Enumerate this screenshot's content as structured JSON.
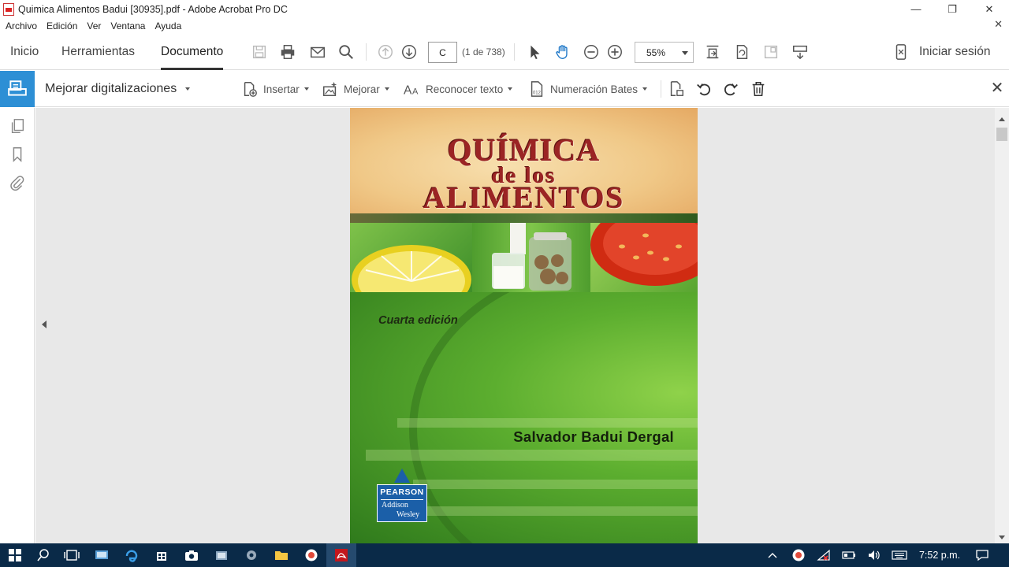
{
  "window": {
    "title": "Quimica Alimentos Badui [30935].pdf - Adobe Acrobat Pro DC",
    "minimize_label": "—",
    "maximize_label": "❐",
    "close_label": "✕"
  },
  "menu": {
    "items": [
      "Archivo",
      "Edición",
      "Ver",
      "Ventana",
      "Ayuda"
    ],
    "close_doc_label": "✕"
  },
  "nav": {
    "tabs": [
      "Inicio",
      "Herramientas",
      "Documento"
    ],
    "active_tab": "Documento",
    "page_input": "C",
    "page_count": "(1 de 738)",
    "zoom": "55%",
    "signin_label": "Iniciar sesión"
  },
  "tool": {
    "title": "Mejorar digitalizaciones",
    "items": [
      "Insertar",
      "Mejorar",
      "Reconocer texto",
      "Numeración Bates"
    ],
    "close_label": "✕"
  },
  "cover": {
    "title_line1": "QUÍMICA",
    "title_line2": "de los",
    "title_line3": "ALIMENTOS",
    "edition": "Cuarta edición",
    "author": "Salvador Badui Dergal",
    "publisher_top": "PEARSON",
    "publisher_bottom_1": "Addison",
    "publisher_bottom_2": "Wesley"
  },
  "taskbar": {
    "time": "7:52 p.m."
  },
  "colors": {
    "accent": "#2d8fd5",
    "taskbar": "#0a2a48",
    "title_red": "#9b2424"
  }
}
